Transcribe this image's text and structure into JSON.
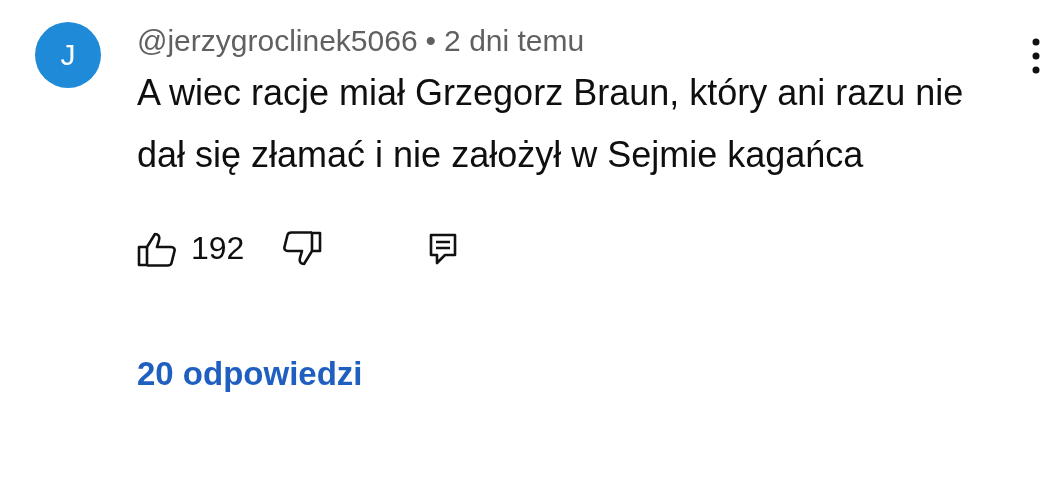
{
  "comment": {
    "avatar": "J",
    "author": "@jerzygroclinek5066",
    "separator": "•",
    "time": "2 dni temu",
    "text": "A wiec racje miał Grzegorz Braun, który ani razu nie dał się złamać i nie założył w Sejmie kagańca",
    "likes": "192",
    "replies": "20 odpowiedzi"
  }
}
